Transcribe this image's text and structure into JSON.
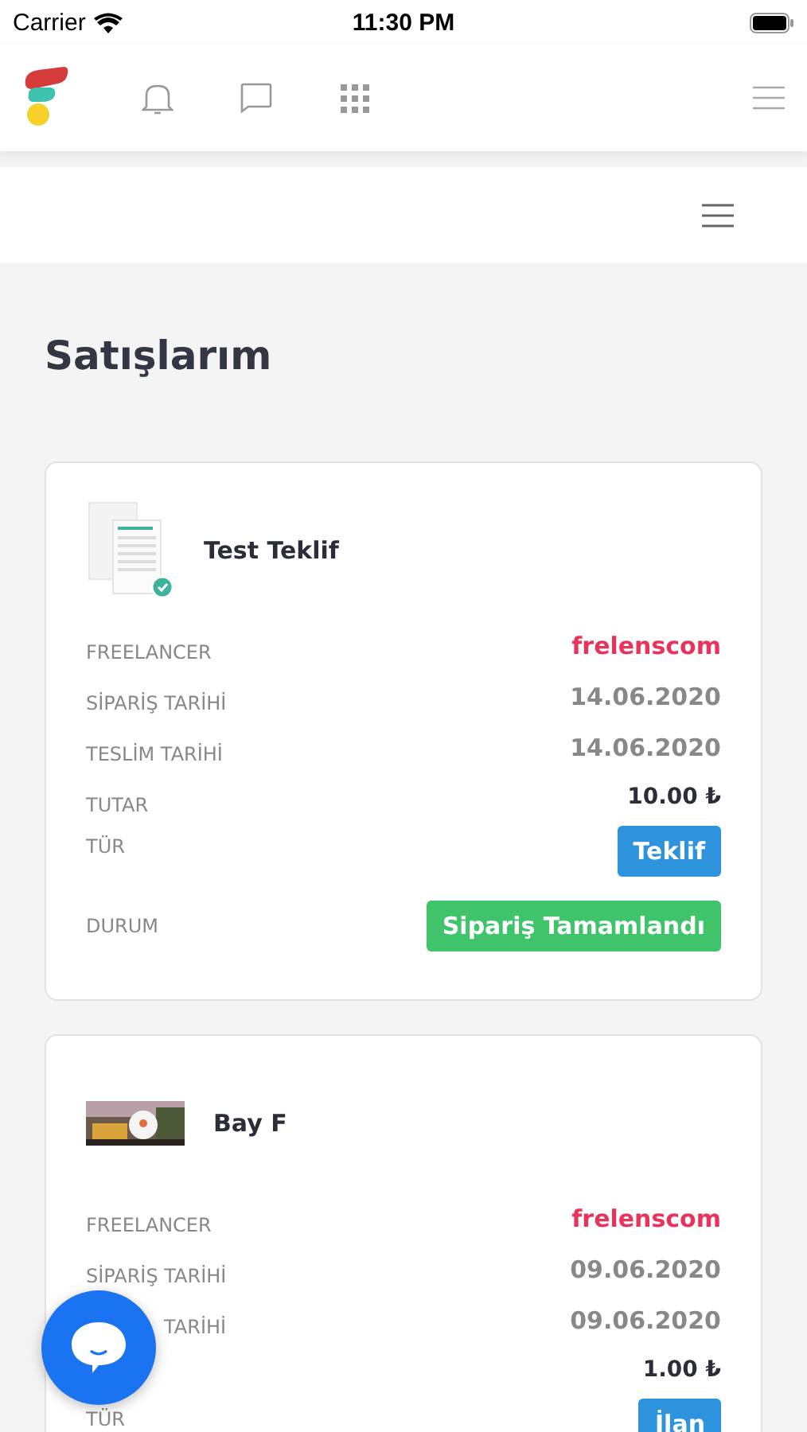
{
  "status_bar": {
    "carrier": "Carrier",
    "time": "11:30 PM"
  },
  "page_title": "Satışlarım",
  "orders": [
    {
      "thumbnail": {
        "kind": "document"
      },
      "title": "Test Teklif",
      "rows": [
        {
          "label": "FREELANCER",
          "value": "frelenscom",
          "kind": "link"
        },
        {
          "label": "SİPARİŞ TARİHİ",
          "value": "14.06.2020",
          "kind": "date"
        },
        {
          "label": "TESLİM TARİHİ",
          "value": "14.06.2020",
          "kind": "date"
        },
        {
          "label": "TUTAR",
          "value": "10.00 ₺",
          "kind": "amount"
        },
        {
          "label": "TÜR",
          "value": "Teklif",
          "kind": "tag"
        },
        {
          "label": "DURUM",
          "value": "Sipariş Tamamlandı",
          "kind": "status"
        }
      ]
    },
    {
      "thumbnail": {
        "kind": "picture"
      },
      "title": "Bay F",
      "rows": [
        {
          "label": "FREELANCER",
          "value": "frelenscom",
          "kind": "link"
        },
        {
          "label": "SİPARİŞ TARİHİ",
          "value": "09.06.2020",
          "kind": "date"
        },
        {
          "label": "TARİHİ",
          "value": "09.06.2020",
          "kind": "date",
          "covered": true
        },
        {
          "value": "1.00 ₺",
          "kind": "amount"
        },
        {
          "label": "TÜR",
          "value": "İlan",
          "kind": "tag"
        }
      ]
    }
  ]
}
